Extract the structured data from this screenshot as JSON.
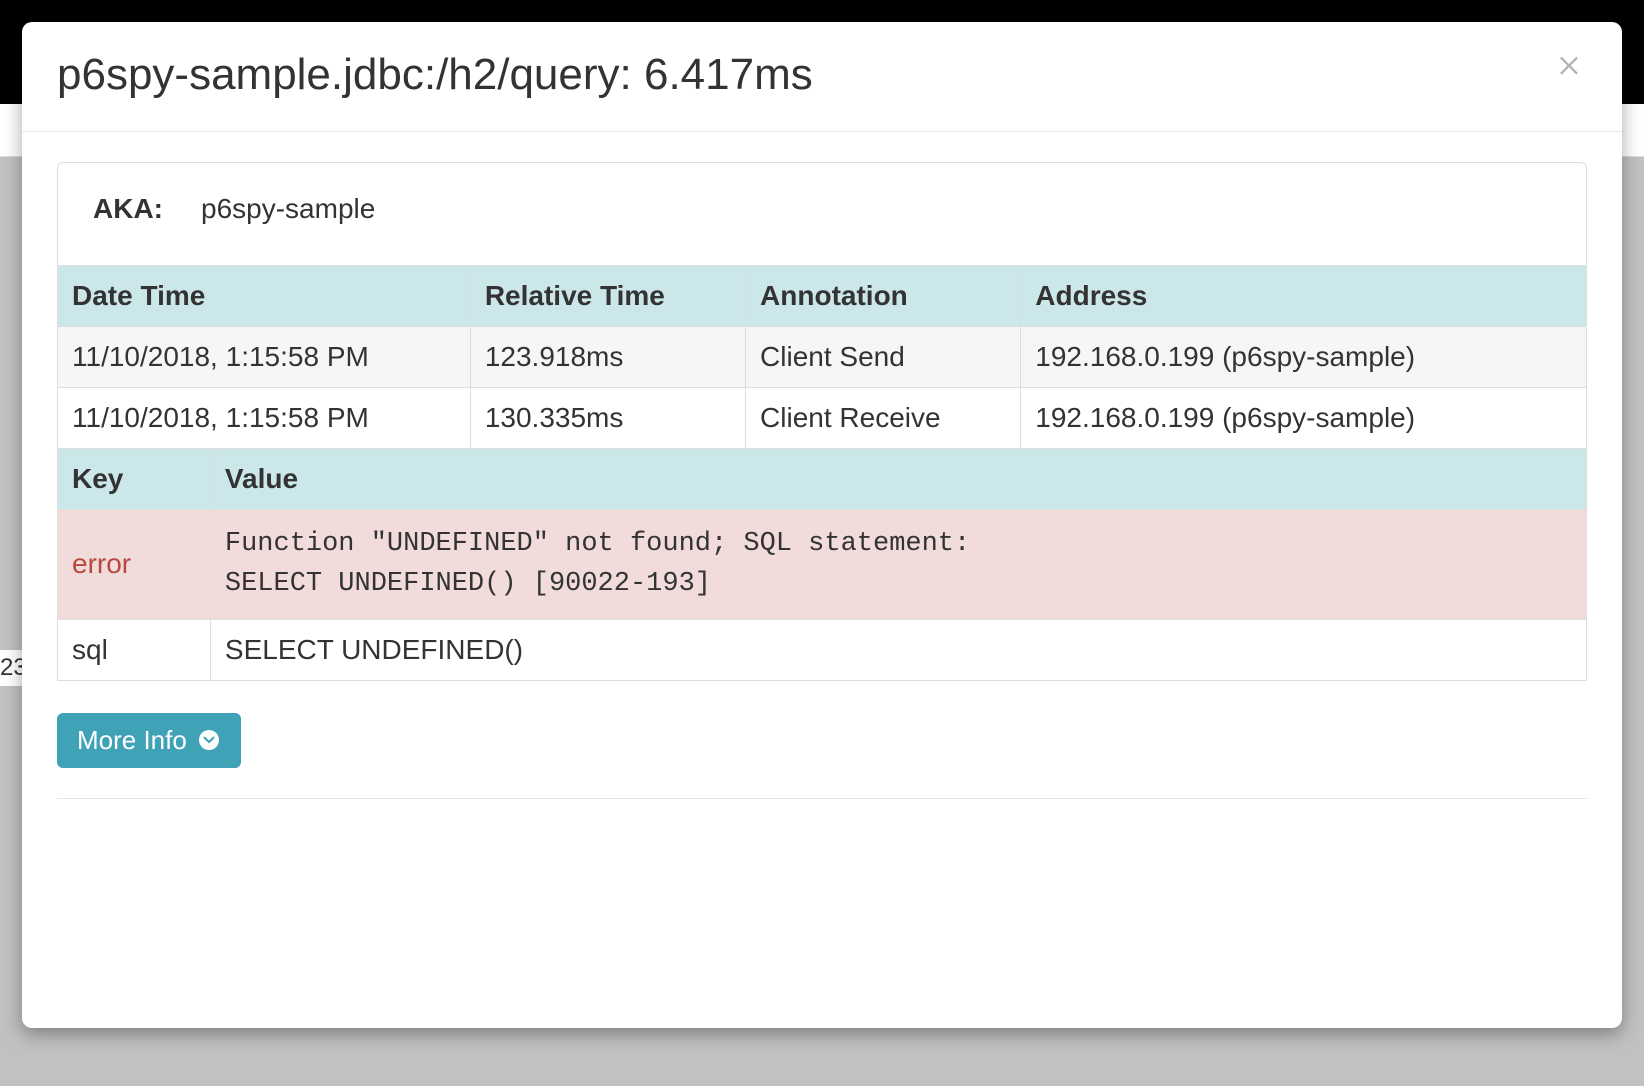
{
  "modal": {
    "title": "p6spy-sample.jdbc:/h2/query: 6.417ms",
    "aka_label": "AKA:",
    "aka_value": "p6spy-sample",
    "events": {
      "headers": {
        "datetime": "Date Time",
        "relative": "Relative Time",
        "annotation": "Annotation",
        "address": "Address"
      },
      "rows": [
        {
          "datetime": "11/10/2018, 1:15:58 PM",
          "relative": "123.918ms",
          "annotation": "Client Send",
          "address": "192.168.0.199 (p6spy-sample)"
        },
        {
          "datetime": "11/10/2018, 1:15:58 PM",
          "relative": "130.335ms",
          "annotation": "Client Receive",
          "address": "192.168.0.199 (p6spy-sample)"
        }
      ]
    },
    "kv": {
      "headers": {
        "key": "Key",
        "value": "Value"
      },
      "rows": [
        {
          "key": "error",
          "value": "Function \"UNDEFINED\" not found; SQL statement:\nSELECT UNDEFINED() [90022-193]",
          "is_error": true,
          "mono": true
        },
        {
          "key": "sql",
          "value": "SELECT UNDEFINED()",
          "is_error": false,
          "mono": false
        }
      ]
    },
    "more_info_label": "More Info"
  },
  "backdrop": {
    "left_fragment": "23"
  }
}
